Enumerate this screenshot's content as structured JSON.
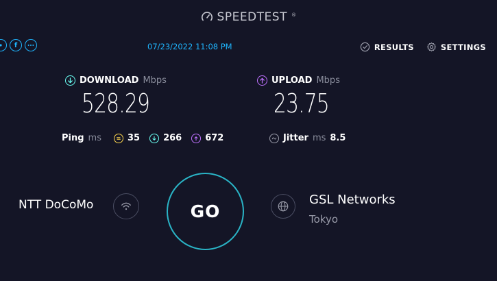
{
  "header": {
    "brand": "SPEEDTEST",
    "brand_mark": "®",
    "datetime": "07/23/2022 11:08 PM",
    "share_icons": [
      "share-icon",
      "facebook-icon",
      "more-icon"
    ],
    "facebook_glyph": "f",
    "results_label": "RESULTS",
    "settings_label": "SETTINGS"
  },
  "download": {
    "label": "DOWNLOAD",
    "unit": "Mbps",
    "value": "528.29",
    "color": "#6afff3"
  },
  "upload": {
    "label": "UPLOAD",
    "unit": "Mbps",
    "value": "23.75",
    "color": "#bf71ff"
  },
  "ping": {
    "label": "Ping",
    "unit": "ms",
    "idle": "35",
    "download": "266",
    "upload": "672",
    "idle_color": "#fbd44d"
  },
  "jitter": {
    "label": "Jitter",
    "unit": "ms",
    "value": "8.5"
  },
  "connection": {
    "isp": "NTT DoCoMo",
    "go_label": "GO",
    "server_name": "GSL Networks",
    "server_location": "Tokyo"
  },
  "colors": {
    "background": "#141526",
    "accent": "#1fb6ff",
    "go_ring": "#2ab4c6"
  }
}
